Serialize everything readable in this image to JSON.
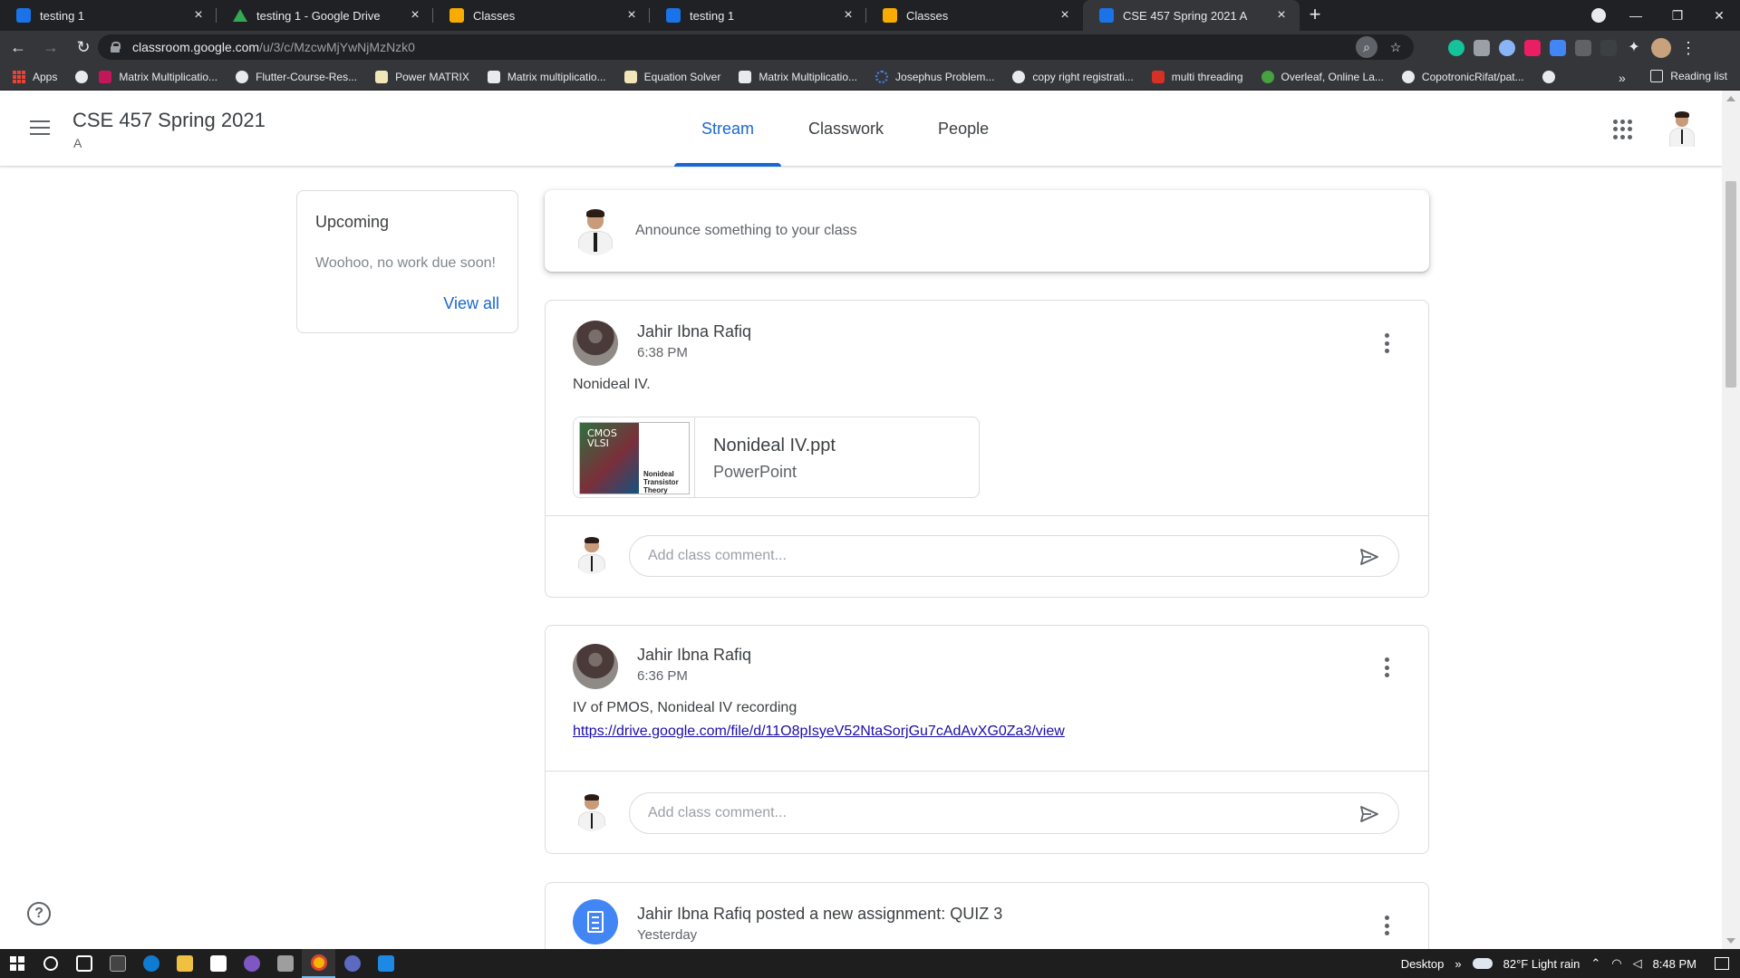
{
  "browser": {
    "tabs": [
      {
        "title": "testing 1",
        "favicon": "classroom-blue",
        "active": false
      },
      {
        "title": "testing 1 - Google Drive",
        "favicon": "drive",
        "active": false
      },
      {
        "title": "Classes",
        "favicon": "classroom-yellow",
        "active": false
      },
      {
        "title": "testing 1",
        "favicon": "classroom-blue",
        "active": false
      },
      {
        "title": "Classes",
        "favicon": "classroom-yellow",
        "active": false
      },
      {
        "title": "CSE 457 Spring 2021 A",
        "favicon": "classroom-blue",
        "active": true
      }
    ],
    "url_host": "classroom.google.com",
    "url_path": "/u/3/c/MzcwMjYwNjMzNzk0",
    "bookmarks": [
      {
        "label": "Apps",
        "color": "#ea4335"
      },
      {
        "label": "",
        "color": "#e8eaed"
      },
      {
        "label": "Matrix Multiplicatio...",
        "color": "#c2185b"
      },
      {
        "label": "Flutter-Course-Res...",
        "color": "#e8eaed"
      },
      {
        "label": "Power MATRIX",
        "color": "#f1e6b8"
      },
      {
        "label": "Matrix multiplicatio...",
        "color": "#e8eaed"
      },
      {
        "label": "Equation Solver",
        "color": "#f1e6b8"
      },
      {
        "label": "Matrix Multiplicatio...",
        "color": "#e8eaed"
      },
      {
        "label": "Josephus Problem...",
        "color": "#4285f4"
      },
      {
        "label": "copy right registrati...",
        "color": "#e8eaed"
      },
      {
        "label": "multi threading",
        "color": "#d93025"
      },
      {
        "label": "Overleaf, Online La...",
        "color": "#47a141"
      },
      {
        "label": "CopotronicRifat/pat...",
        "color": "#e8eaed"
      }
    ],
    "bookmarks_more": "»",
    "reading_list": "Reading list"
  },
  "classroom": {
    "class_title": "CSE 457 Spring 2021",
    "section": "A",
    "tabs": [
      "Stream",
      "Classwork",
      "People"
    ],
    "active_tab": "Stream",
    "accent": "#1967d2"
  },
  "upcoming": {
    "title": "Upcoming",
    "empty_text": "Woohoo, no work due soon!",
    "view_all": "View all"
  },
  "announce": {
    "placeholder": "Announce something to your class"
  },
  "posts": [
    {
      "author": "Jahir Ibna Rafiq",
      "time": "6:38 PM",
      "body": "Nonideal IV.",
      "attachment": {
        "name": "Nonideal IV.ppt",
        "type": "PowerPoint",
        "thumb_title": "CMOS VLSI",
        "thumb_subtitle": "Nonideal Transistor Theory"
      },
      "comment_placeholder": "Add class comment..."
    },
    {
      "author": "Jahir Ibna Rafiq",
      "time": "6:36 PM",
      "body": "IV of PMOS, Nonideal IV recording",
      "link": "https://drive.google.com/file/d/11O8pIsyeV52NtaSorjGu7cAdAvXG0Za3/view",
      "comment_placeholder": "Add class comment..."
    },
    {
      "author_line": "Jahir Ibna Rafiq posted a new assignment: QUIZ 3",
      "time": "Yesterday"
    }
  ],
  "help_glyph": "?",
  "taskbar": {
    "desktop_label": "Desktop",
    "chevron": "»",
    "weather": "82°F  Light rain",
    "time": "8:48 PM"
  }
}
